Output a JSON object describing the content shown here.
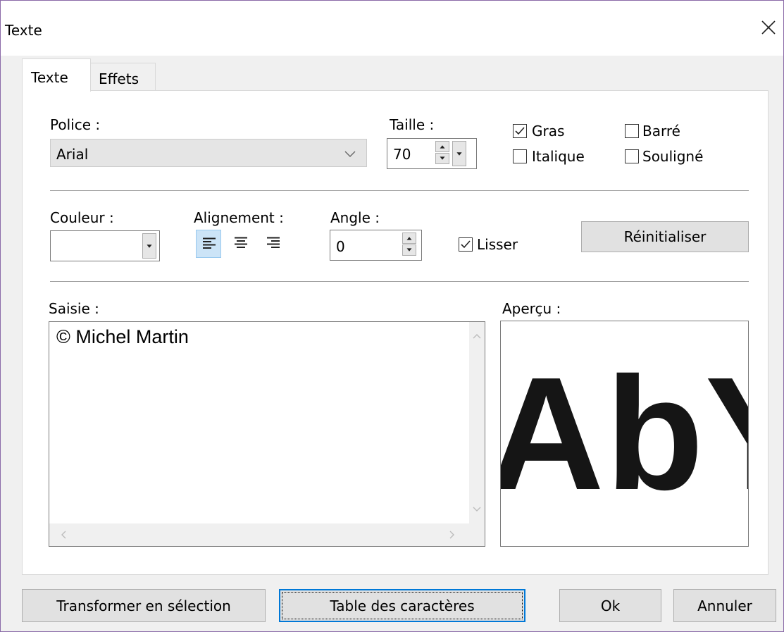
{
  "window": {
    "title": "Texte"
  },
  "tabs": [
    {
      "label": "Texte",
      "active": true
    },
    {
      "label": "Effets",
      "active": false
    }
  ],
  "font": {
    "label": "Police :",
    "value": "Arial"
  },
  "size": {
    "label": "Taille :",
    "value": "70"
  },
  "style": {
    "bold": {
      "label": "Gras",
      "checked": true
    },
    "italic": {
      "label": "Italique",
      "checked": false
    },
    "strike": {
      "label": "Barré",
      "checked": false
    },
    "underline": {
      "label": "Souligné",
      "checked": false
    }
  },
  "color": {
    "label": "Couleur :",
    "value_hex": "#ffffff"
  },
  "alignment": {
    "label": "Alignement :",
    "options": [
      "left",
      "center",
      "right"
    ],
    "selected": "left"
  },
  "angle": {
    "label": "Angle :",
    "value": "0"
  },
  "smooth": {
    "label": "Lisser",
    "checked": true
  },
  "reset_button": "Réinitialiser",
  "input": {
    "label": "Saisie :",
    "text": "© Michel Martin"
  },
  "preview": {
    "label": "Aperçu :",
    "text": "AbYz"
  },
  "buttons": {
    "to_selection": "Transformer en sélection",
    "char_table": "Table des caractères",
    "ok": "Ok",
    "cancel": "Annuler"
  },
  "colors": {
    "accent": "#0078d7",
    "selection_bg": "#cce4f7",
    "dialog_bg": "#f0f0f0"
  }
}
